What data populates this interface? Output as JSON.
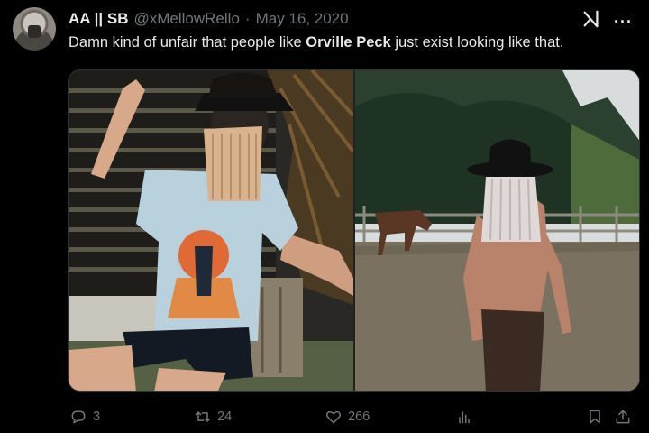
{
  "tweet": {
    "display_name": "AA || SB",
    "handle": "@xMellowRello",
    "separator": "·",
    "date": "May 16, 2020",
    "text_before": "Damn kind of unfair that people like ",
    "text_bold": "Orville Peck",
    "text_after": " just exist looking like that."
  },
  "actions": {
    "reply_count": "3",
    "retweet_count": "24",
    "like_count": "266"
  },
  "icons": {
    "avatar": "profile-photo",
    "grok": "grok-icon",
    "more": "more-icon",
    "reply": "reply-icon",
    "retweet": "retweet-icon",
    "like": "heart-icon",
    "views": "analytics-icon",
    "bookmark": "bookmark-icon",
    "share": "share-icon"
  },
  "more_glyph": "···",
  "colors": {
    "background": "#000000",
    "text_primary": "#e7e9ea",
    "text_secondary": "#71767b",
    "border": "#2f3336"
  }
}
